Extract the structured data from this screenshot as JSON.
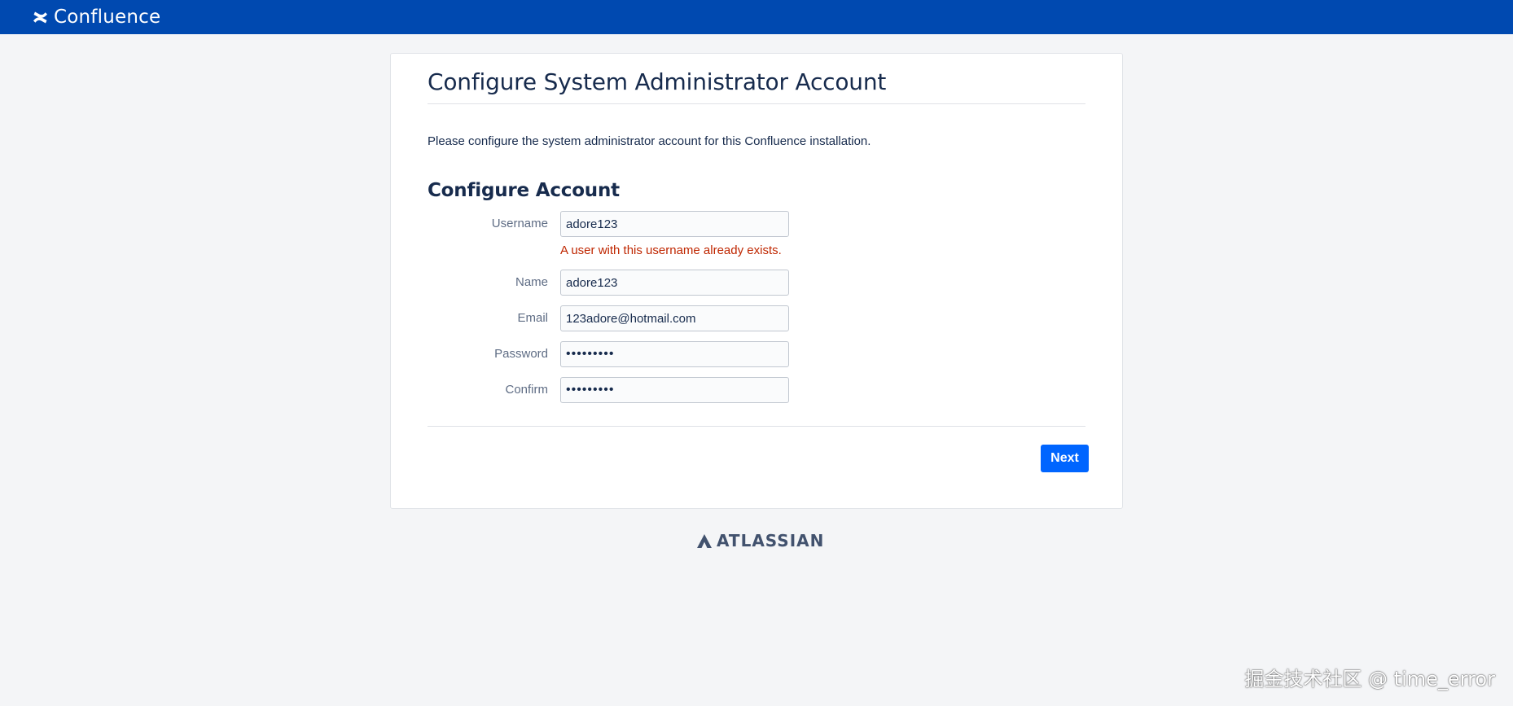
{
  "header": {
    "product_name": "Confluence",
    "logo_icon": "confluence-logo-icon",
    "bar_color": "#0049b0"
  },
  "page": {
    "title": "Configure System Administrator Account",
    "intro": "Please configure the system administrator account for this Confluence installation.",
    "section_title": "Configure Account"
  },
  "form": {
    "fields": [
      {
        "label": "Username",
        "value": "adore123"
      },
      {
        "label": "Name",
        "value": "adore123"
      },
      {
        "label": "Email",
        "value": "123adore@hotmail.com"
      },
      {
        "label": "Password",
        "value": "•••••••••"
      },
      {
        "label": "Confirm",
        "value": "•••••••••"
      }
    ],
    "username_error": "A user with this username already exists.",
    "next_label": "Next",
    "accent_color": "#0065ff",
    "error_color": "#bf2600"
  },
  "footer": {
    "brand": "ATLASSIAN",
    "logo_icon": "atlassian-logo-icon"
  },
  "watermark": "掘金技术社区 @ time_error"
}
